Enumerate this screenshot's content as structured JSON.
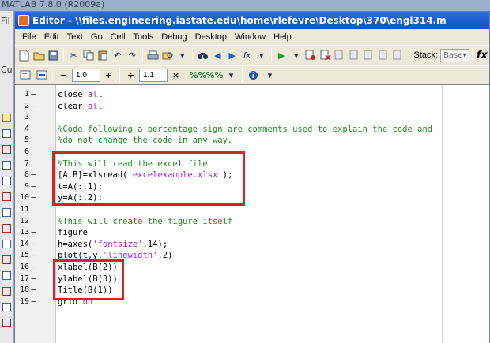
{
  "background": {
    "title": "MATLAB 7.8.0 (R2009a)",
    "left_labels": [
      "Fil",
      "Cu"
    ]
  },
  "editor": {
    "title": "Editor - \\\\files.engineering.iastate.edu\\home\\rlefevre\\Desktop\\370\\engl314.m"
  },
  "menu": [
    "File",
    "Edit",
    "Text",
    "Go",
    "Cell",
    "Tools",
    "Debug",
    "Desktop",
    "Window",
    "Help"
  ],
  "toolbar": {
    "stack_label": "Stack:",
    "stack_value": "Base",
    "fx_label": "fx"
  },
  "cell_toolbar": {
    "minus": "−",
    "value1": "1.0",
    "plus": "+",
    "divide": "÷",
    "value2": "1.1",
    "times": "×"
  },
  "code_lines": [
    {
      "n": "1",
      "dash": "−",
      "segs": [
        {
          "t": "close ",
          "c": ""
        },
        {
          "t": "all",
          "c": "str"
        }
      ]
    },
    {
      "n": "2",
      "dash": "−",
      "segs": [
        {
          "t": "clear ",
          "c": ""
        },
        {
          "t": "all",
          "c": "str"
        }
      ]
    },
    {
      "n": "3",
      "dash": "",
      "segs": []
    },
    {
      "n": "4",
      "dash": "",
      "segs": [
        {
          "t": "%Code following a percentage sign are comments used to explain the code and",
          "c": "cm"
        }
      ]
    },
    {
      "n": "5",
      "dash": "",
      "segs": [
        {
          "t": "%do not change the code in any way.",
          "c": "cm"
        }
      ]
    },
    {
      "n": "6",
      "dash": "",
      "segs": []
    },
    {
      "n": "7",
      "dash": "",
      "segs": [
        {
          "t": "%This will read the excel file",
          "c": "cm"
        }
      ]
    },
    {
      "n": "8",
      "dash": "−",
      "segs": [
        {
          "t": "[A,B]=xlsread(",
          "c": ""
        },
        {
          "t": "'excelexample.xlsx'",
          "c": "str"
        },
        {
          "t": ");",
          "c": ""
        }
      ]
    },
    {
      "n": "9",
      "dash": "−",
      "segs": [
        {
          "t": "t=A(:,1);",
          "c": ""
        }
      ]
    },
    {
      "n": "10",
      "dash": "−",
      "segs": [
        {
          "t": "y=A(:,2);",
          "c": ""
        }
      ]
    },
    {
      "n": "11",
      "dash": "",
      "segs": []
    },
    {
      "n": "12",
      "dash": "",
      "segs": [
        {
          "t": "%This will create the figure itself",
          "c": "cm"
        }
      ]
    },
    {
      "n": "13",
      "dash": "−",
      "segs": [
        {
          "t": "figure",
          "c": ""
        }
      ]
    },
    {
      "n": "14",
      "dash": "−",
      "segs": [
        {
          "t": "h=axes(",
          "c": ""
        },
        {
          "t": "'fontsize'",
          "c": "str"
        },
        {
          "t": ",14);",
          "c": ""
        }
      ]
    },
    {
      "n": "15",
      "dash": "−",
      "segs": [
        {
          "t": "plot(t,y,",
          "c": ""
        },
        {
          "t": "'linewidth'",
          "c": "str"
        },
        {
          "t": ",2)",
          "c": ""
        }
      ]
    },
    {
      "n": "16",
      "dash": "−",
      "segs": [
        {
          "t": "xlabel(B(2))",
          "c": ""
        }
      ]
    },
    {
      "n": "17",
      "dash": "−",
      "segs": [
        {
          "t": "ylabel(B(3))",
          "c": ""
        }
      ]
    },
    {
      "n": "18",
      "dash": "−",
      "segs": [
        {
          "t": "Title(B(1))",
          "c": ""
        }
      ]
    },
    {
      "n": "19",
      "dash": "−",
      "segs": [
        {
          "t": "grid ",
          "c": ""
        },
        {
          "t": "on",
          "c": "str"
        }
      ]
    }
  ],
  "colors": {
    "comment": "#228b22",
    "string": "#a020f0",
    "highlight": "#d8202a",
    "title_bar": "#1a50c8"
  }
}
